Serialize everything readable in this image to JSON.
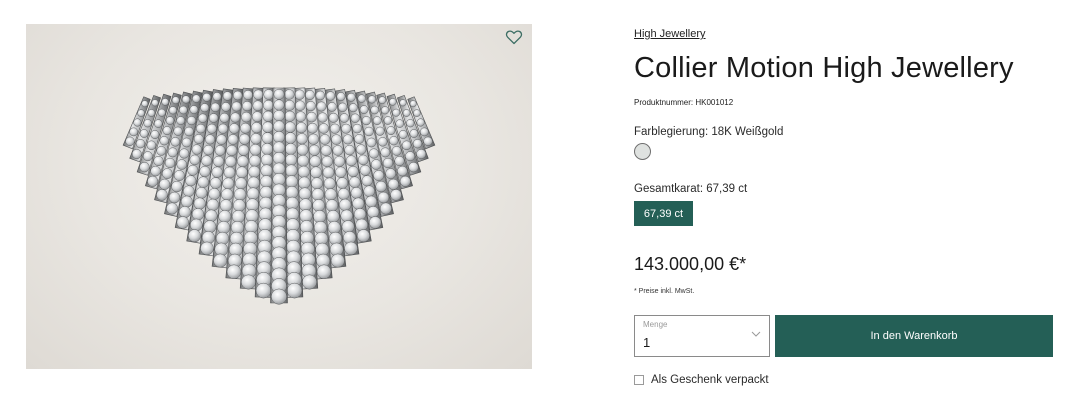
{
  "product": {
    "breadcrumb": "High Jewellery",
    "title": "Collier Motion High Jewellery",
    "sku": "Produktnummer: HK001012",
    "alloy_label": "Farblegierung: 18K Weißgold",
    "alloy_swatch_color": "#dfe2e0",
    "carat_label": "Gesamtkarat: 67,39 ct",
    "carat_option": "67,39 ct",
    "price": "143.000,00 €*",
    "tax_note": "* Preise inkl. MwSt."
  },
  "purchase": {
    "qty_caption": "Menge",
    "qty_value": "1",
    "cart_label": "In den Warenkorb",
    "gift_label": "Als Geschenk verpackt"
  },
  "colors": {
    "accent": "#245f56",
    "image_background": "#e9e6e1"
  },
  "icons": {
    "favorite": "heart-outline-icon",
    "dropdown": "chevron-down-icon",
    "gift": "checkbox-unchecked"
  }
}
